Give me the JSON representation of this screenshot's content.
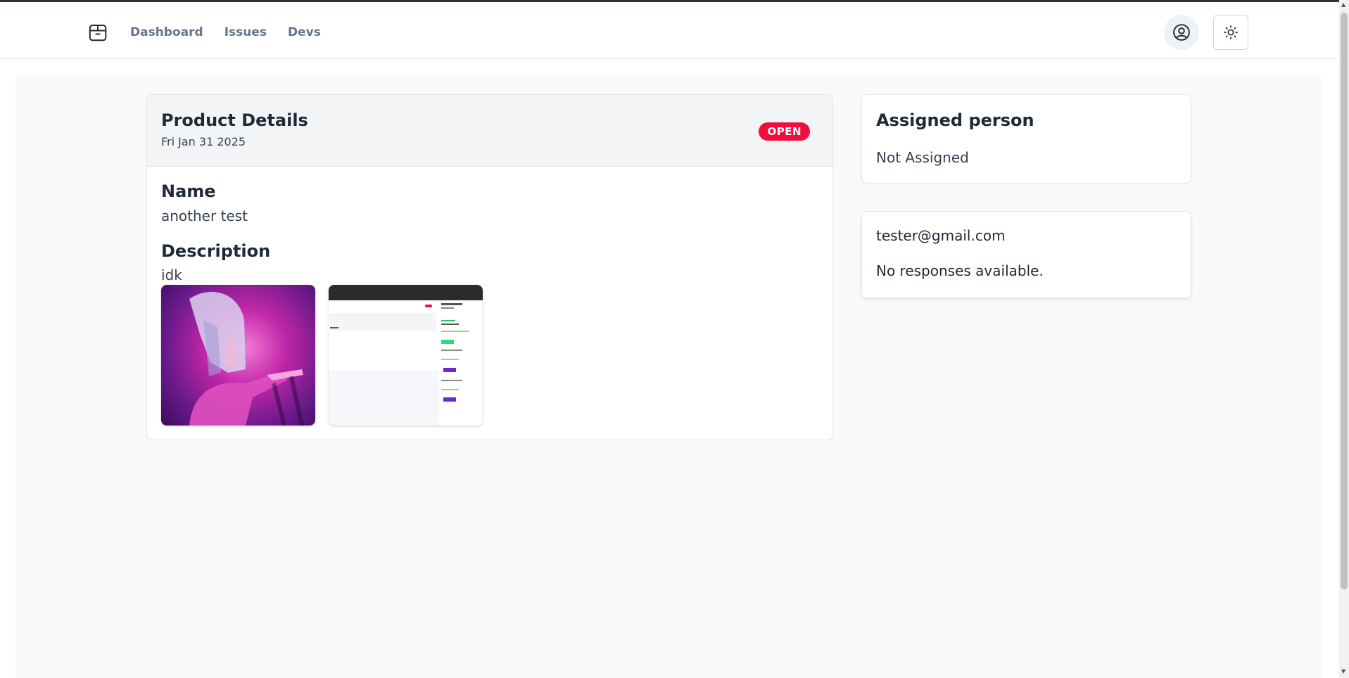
{
  "nav": {
    "items": [
      "Dashboard",
      "Issues",
      "Devs"
    ]
  },
  "icons": {
    "logo": "package-icon",
    "profile": "user-circle-icon",
    "theme": "sun-icon"
  },
  "issue": {
    "title": "Product Details",
    "date": "Fri Jan 31 2025",
    "status": "OPEN",
    "name_label": "Name",
    "name_value": "another test",
    "description_label": "Description",
    "description_value": "idk"
  },
  "assigned": {
    "title": "Assigned person",
    "value": "Not Assigned"
  },
  "responses": {
    "email": "tester@gmail.com",
    "empty_text": "No responses available."
  },
  "colors": {
    "status_open": "#f00f3c"
  }
}
